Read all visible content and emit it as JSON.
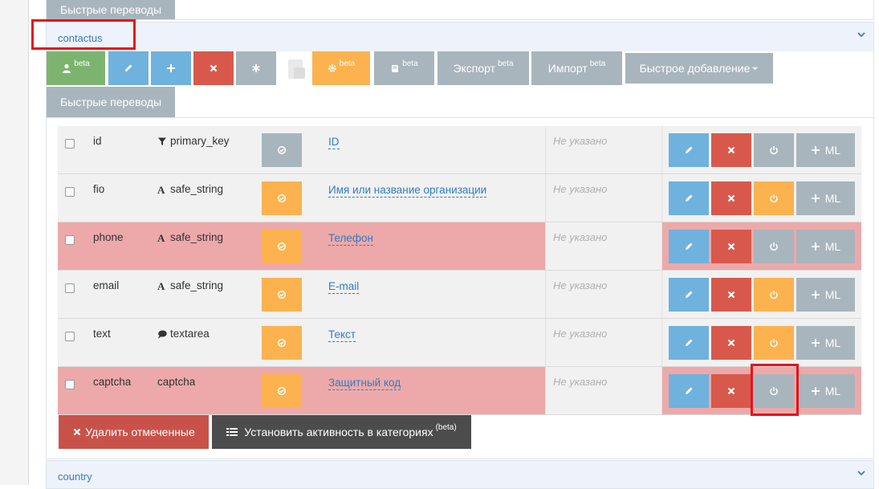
{
  "top_panel": {
    "quick_translations": "Быстрые переводы"
  },
  "section": {
    "title": "contactus",
    "toolbar": {
      "beta_badge": "beta",
      "export_label": "Экспорт",
      "import_label": "Импорт",
      "quick_add_label": "Быстрое добавление",
      "quick_translations_label": "Быстрые переводы"
    },
    "rows": [
      {
        "name": "id",
        "type_icon": "filter-icon",
        "type": "primary_key",
        "label": "ID",
        "not_set": "Не указано",
        "highlight": false,
        "active": false
      },
      {
        "name": "fio",
        "type_icon": "font-icon",
        "type": "safe_string",
        "label": "Имя или название организации",
        "not_set": "Не указано",
        "highlight": false,
        "active": true
      },
      {
        "name": "phone",
        "type_icon": "font-icon",
        "type": "safe_string",
        "label": "Телефон",
        "not_set": "Не указано",
        "highlight": true,
        "active": true
      },
      {
        "name": "email",
        "type_icon": "font-icon",
        "type": "safe_string",
        "label": "E-mail",
        "not_set": "Не указано",
        "highlight": false,
        "active": true
      },
      {
        "name": "text",
        "type_icon": "comment-icon",
        "type": "textarea",
        "label": "Текст",
        "not_set": "Не указано",
        "highlight": false,
        "active": true
      },
      {
        "name": "captcha",
        "type_icon": "",
        "type": "captcha",
        "label": "Защитный код",
        "not_set": "Не указано",
        "highlight": true,
        "active": true
      }
    ],
    "ml_label": "ML",
    "footer": {
      "delete_checked": "Удалить отмеченные",
      "set_activity": "Установить активность в категориях",
      "set_activity_badge": "(beta)"
    }
  },
  "next_section": {
    "title": "country"
  },
  "colors": {
    "accent_red": "#e3141b",
    "blue": "#6fb2dd",
    "red": "#d8594c",
    "orange": "#fcb24e",
    "grey": "#a8b5bd",
    "green": "#7cb46f",
    "row_highlight": "#eda9a9",
    "link": "#2f7dc3"
  }
}
